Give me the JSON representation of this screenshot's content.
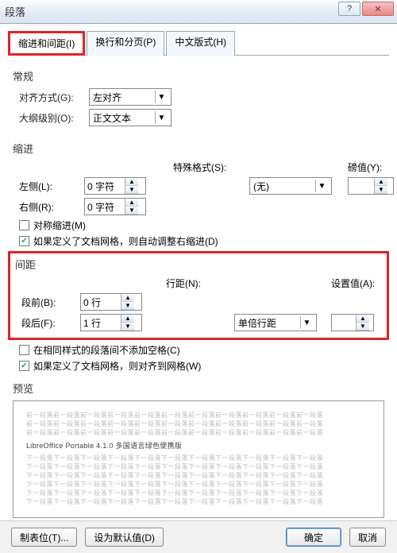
{
  "title": "段落",
  "tabs": {
    "t1": "缩进和间距(I)",
    "t2": "换行和分页(P)",
    "t3": "中文版式(H)"
  },
  "general": {
    "label": "常规",
    "align_label": "对齐方式(G):",
    "align_value": "左对齐",
    "outline_label": "大纲级别(O):",
    "outline_value": "正文文本"
  },
  "indent": {
    "label": "缩进",
    "left_label": "左侧(L):",
    "left_value": "0 字符",
    "right_label": "右侧(R):",
    "right_value": "0 字符",
    "special_label": "特殊格式(S):",
    "special_value": "(无)",
    "by_label": "磅值(Y):",
    "by_value": "",
    "mirror": "对称缩进(M)",
    "autogrid": "如果定义了文档网格，则自动调整右缩进(D)"
  },
  "spacing": {
    "label": "间距",
    "before_label": "段前(B):",
    "before_value": "0 行",
    "after_label": "段后(F):",
    "after_value": "1 行",
    "line_label": "行距(N):",
    "line_value": "单倍行距",
    "at_label": "设置值(A):",
    "at_value": "",
    "samestyle": "在相同样式的段落间不添加空格(C)",
    "snapgrid": "如果定义了文档网格，则对齐到网格(W)"
  },
  "preview": {
    "label": "预览",
    "filler": "前一段落前一段落前一段落前一段落前一段落前一段落前一段落前一段落前一段落前一段落前一段落",
    "filler2": "下一段落下一段落下一段落下一段落下一段落下一段落下一段落下一段落下一段落下一段落下一段落",
    "main": "LibreOffice Portable 4.1.0 多国语言绿色便携版"
  },
  "buttons": {
    "tabs": "制表位(T)...",
    "default": "设为默认值(D)",
    "ok": "确定",
    "cancel": "取消"
  }
}
